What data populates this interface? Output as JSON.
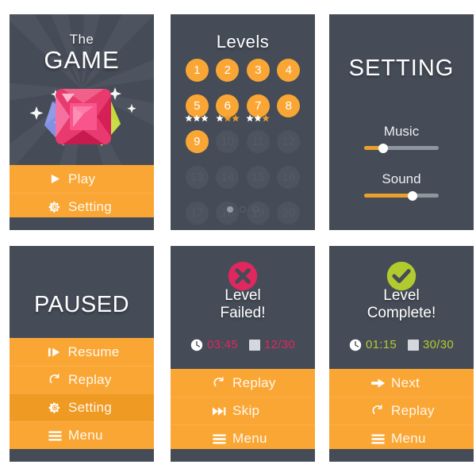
{
  "theme": {
    "dark": "#454c57",
    "orange": "#faa634",
    "orange_hover": "#ef9a22",
    "white": "#ffffff",
    "pink": "#e0275e",
    "green": "#b1cb2f",
    "locked_circle": "#4d5460",
    "slider_track": "#8f969f",
    "slider_fill": "#e9a02c"
  },
  "title_screen": {
    "name": "game-title-screen",
    "pre_title": "The",
    "title": "GAME",
    "artwork": "three-gems",
    "menu": [
      {
        "label": "Play",
        "icon": "play-icon"
      },
      {
        "label": "Setting",
        "icon": "gear-icon"
      }
    ]
  },
  "levels_screen": {
    "name": "levels-screen",
    "title": "Levels",
    "levels": [
      {
        "number": "1",
        "unlocked": true,
        "stars": 0
      },
      {
        "number": "2",
        "unlocked": true,
        "stars": 0
      },
      {
        "number": "3",
        "unlocked": true,
        "stars": 0
      },
      {
        "number": "4",
        "unlocked": true,
        "stars": 0
      },
      {
        "number": "5",
        "unlocked": true,
        "stars": 3
      },
      {
        "number": "6",
        "unlocked": true,
        "stars": 1
      },
      {
        "number": "7",
        "unlocked": true,
        "stars": 2
      },
      {
        "number": "8",
        "unlocked": true,
        "stars": 0
      },
      {
        "number": "9",
        "unlocked": true,
        "stars": 0
      },
      {
        "number": "10",
        "unlocked": false,
        "stars": 0
      },
      {
        "number": "11",
        "unlocked": false,
        "stars": 0
      },
      {
        "number": "12",
        "unlocked": false,
        "stars": 0
      },
      {
        "number": "13",
        "unlocked": false,
        "stars": 0
      },
      {
        "number": "14",
        "unlocked": false,
        "stars": 0
      },
      {
        "number": "15",
        "unlocked": false,
        "stars": 0
      },
      {
        "number": "16",
        "unlocked": false,
        "stars": 0
      },
      {
        "number": "17",
        "unlocked": false,
        "stars": 0
      },
      {
        "number": "18",
        "unlocked": false,
        "stars": 0
      },
      {
        "number": "19",
        "unlocked": false,
        "stars": 0
      },
      {
        "number": "20",
        "unlocked": false,
        "stars": 0
      }
    ],
    "max_stars_per_level": 3,
    "pagination": {
      "pages": 3,
      "active_index": 0
    }
  },
  "setting_screen": {
    "name": "setting-screen",
    "title": "SETTING",
    "sliders": [
      {
        "label": "Music",
        "value_percent": 25
      },
      {
        "label": "Sound",
        "value_percent": 65
      }
    ]
  },
  "paused_screen": {
    "name": "paused-screen",
    "title": "PAUSED",
    "menu": [
      {
        "label": "Resume",
        "icon": "play-pause-icon",
        "highlighted": false
      },
      {
        "label": "Replay",
        "icon": "replay-icon",
        "highlighted": false
      },
      {
        "label": "Setting",
        "icon": "gear-icon",
        "highlighted": true
      },
      {
        "label": "Menu",
        "icon": "hamburger-icon",
        "highlighted": false
      }
    ]
  },
  "level_failed_screen": {
    "name": "level-failed-screen",
    "badge_icon": "x-circle-icon",
    "title_line1": "Level",
    "title_line2": "Failed!",
    "stats": [
      {
        "icon": "clock-icon",
        "value": "03:45"
      },
      {
        "icon": "gem-block-icon",
        "value": "12/30"
      }
    ],
    "menu": [
      {
        "label": "Replay",
        "icon": "replay-icon"
      },
      {
        "label": "Skip",
        "icon": "skip-icon"
      },
      {
        "label": "Menu",
        "icon": "hamburger-icon"
      }
    ]
  },
  "level_complete_screen": {
    "name": "level-complete-screen",
    "badge_icon": "check-circle-icon",
    "title_line1": "Level",
    "title_line2": "Complete!",
    "stats": [
      {
        "icon": "clock-icon",
        "value": "01:15"
      },
      {
        "icon": "gem-block-icon",
        "value": "30/30"
      }
    ],
    "menu": [
      {
        "label": "Next",
        "icon": "arrow-right-icon"
      },
      {
        "label": "Replay",
        "icon": "replay-icon"
      },
      {
        "label": "Menu",
        "icon": "hamburger-icon"
      }
    ]
  }
}
